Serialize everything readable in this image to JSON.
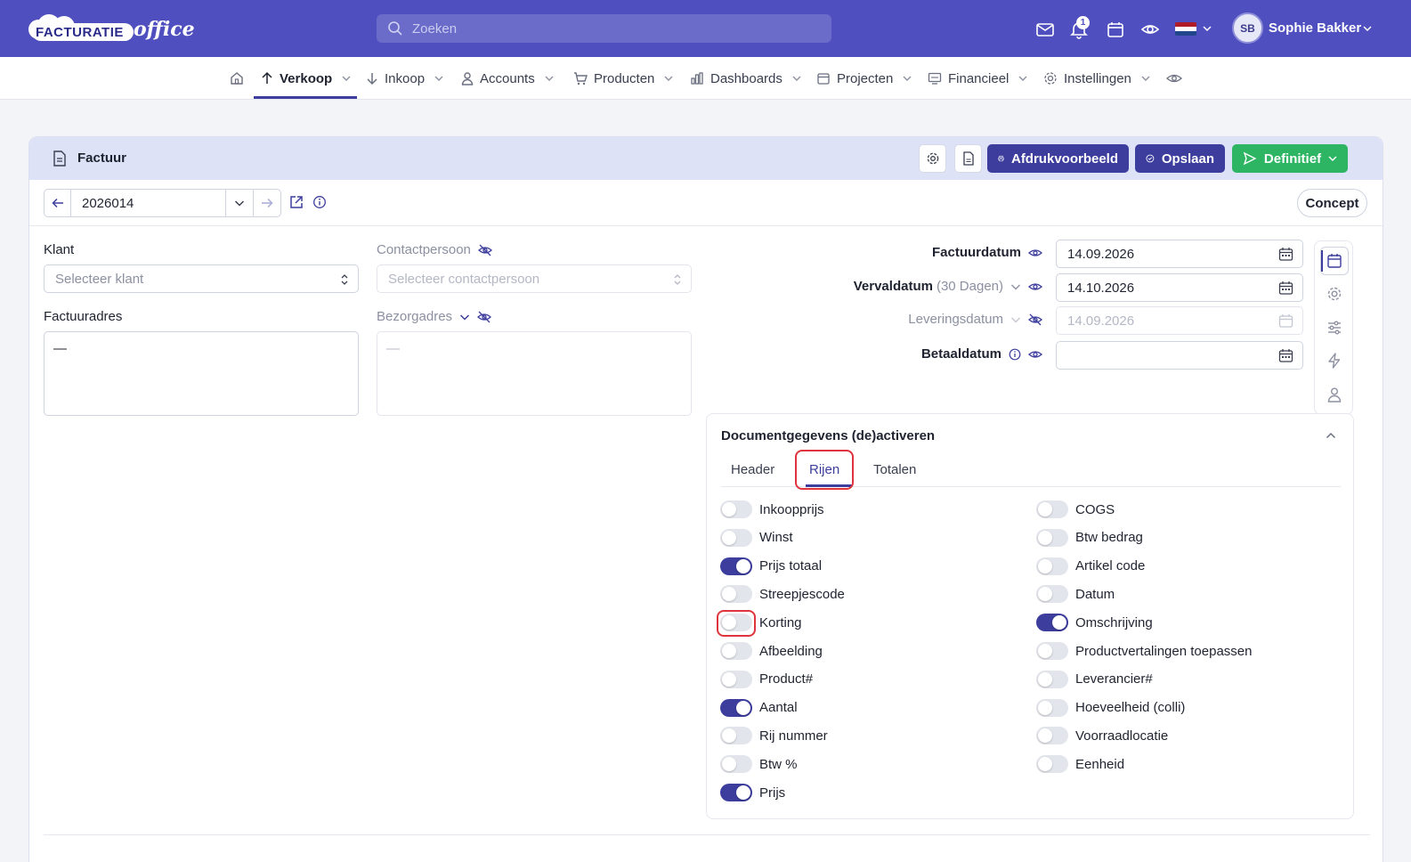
{
  "topbar": {
    "logo_text": "FACTURATIE",
    "logo_suffix": "office",
    "search_placeholder": "Zoeken",
    "notification_count": "1",
    "user_initials": "SB",
    "user_name": "Sophie Bakker",
    "colors": {
      "brand": "#4f4fbf"
    }
  },
  "nav": {
    "items": [
      {
        "label": "Verkoop",
        "icon": "arrow-up-icon"
      },
      {
        "label": "Inkoop",
        "icon": "arrow-down-icon"
      },
      {
        "label": "Accounts",
        "icon": "user-icon"
      },
      {
        "label": "Producten",
        "icon": "cart-icon"
      },
      {
        "label": "Dashboards",
        "icon": "bar-chart-icon"
      },
      {
        "label": "Projecten",
        "icon": "calendar-icon"
      },
      {
        "label": "Financieel",
        "icon": "monitor-icon"
      },
      {
        "label": "Instellingen",
        "icon": "gear-icon"
      }
    ],
    "active": "Verkoop"
  },
  "card": {
    "title": "Factuur",
    "print_preview_label": "Afdrukvoorbeeld",
    "save_label": "Opslaan",
    "final_label": "Definitief",
    "invoice_number": "2026014",
    "status": "Concept"
  },
  "form": {
    "client_label": "Klant",
    "client_placeholder": "Selecteer klant",
    "contact_label": "Contactpersoon",
    "contact_placeholder": "Selecteer contactpersoon",
    "invoice_address_label": "Factuuradres",
    "invoice_address_value": "—",
    "delivery_address_label": "Bezorgadres",
    "delivery_address_value": "—"
  },
  "dates": {
    "invoice_date_label": "Factuurdatum",
    "invoice_date": "14.09.2026",
    "due_date_label": "Vervaldatum",
    "due_date_hint": "(30 Dagen)",
    "due_date": "14.10.2026",
    "delivery_date_label": "Leveringsdatum",
    "delivery_date": "14.09.2026",
    "paid_date_label": "Betaaldatum",
    "paid_date": ""
  },
  "panel": {
    "title": "Documentgegevens (de)activeren",
    "tabs": [
      "Header",
      "Rijen",
      "Totalen"
    ],
    "active_tab": "Rijen",
    "left_toggles": [
      {
        "label": "Inkoopprijs",
        "on": false
      },
      {
        "label": "Winst",
        "on": false
      },
      {
        "label": "Prijs totaal",
        "on": true
      },
      {
        "label": "Streepjescode",
        "on": false
      },
      {
        "label": "Korting",
        "on": false
      },
      {
        "label": "Afbeelding",
        "on": false
      },
      {
        "label": "Product#",
        "on": false
      },
      {
        "label": "Aantal",
        "on": true
      },
      {
        "label": "Rij nummer",
        "on": false
      },
      {
        "label": "Btw %",
        "on": false
      },
      {
        "label": "Prijs",
        "on": true
      }
    ],
    "right_toggles": [
      {
        "label": "COGS",
        "on": false
      },
      {
        "label": "Btw bedrag",
        "on": false
      },
      {
        "label": "Artikel code",
        "on": false
      },
      {
        "label": "Datum",
        "on": false
      },
      {
        "label": "Omschrijving",
        "on": true
      },
      {
        "label": "Productvertalingen toepassen",
        "on": false
      },
      {
        "label": "Leverancier#",
        "on": false
      },
      {
        "label": "Hoeveelheid (colli)",
        "on": false
      },
      {
        "label": "Voorraadlocatie",
        "on": false
      },
      {
        "label": "Eenheid",
        "on": false
      }
    ],
    "highlight_color": "#e0343c",
    "accent_color": "#3c3d9c"
  }
}
